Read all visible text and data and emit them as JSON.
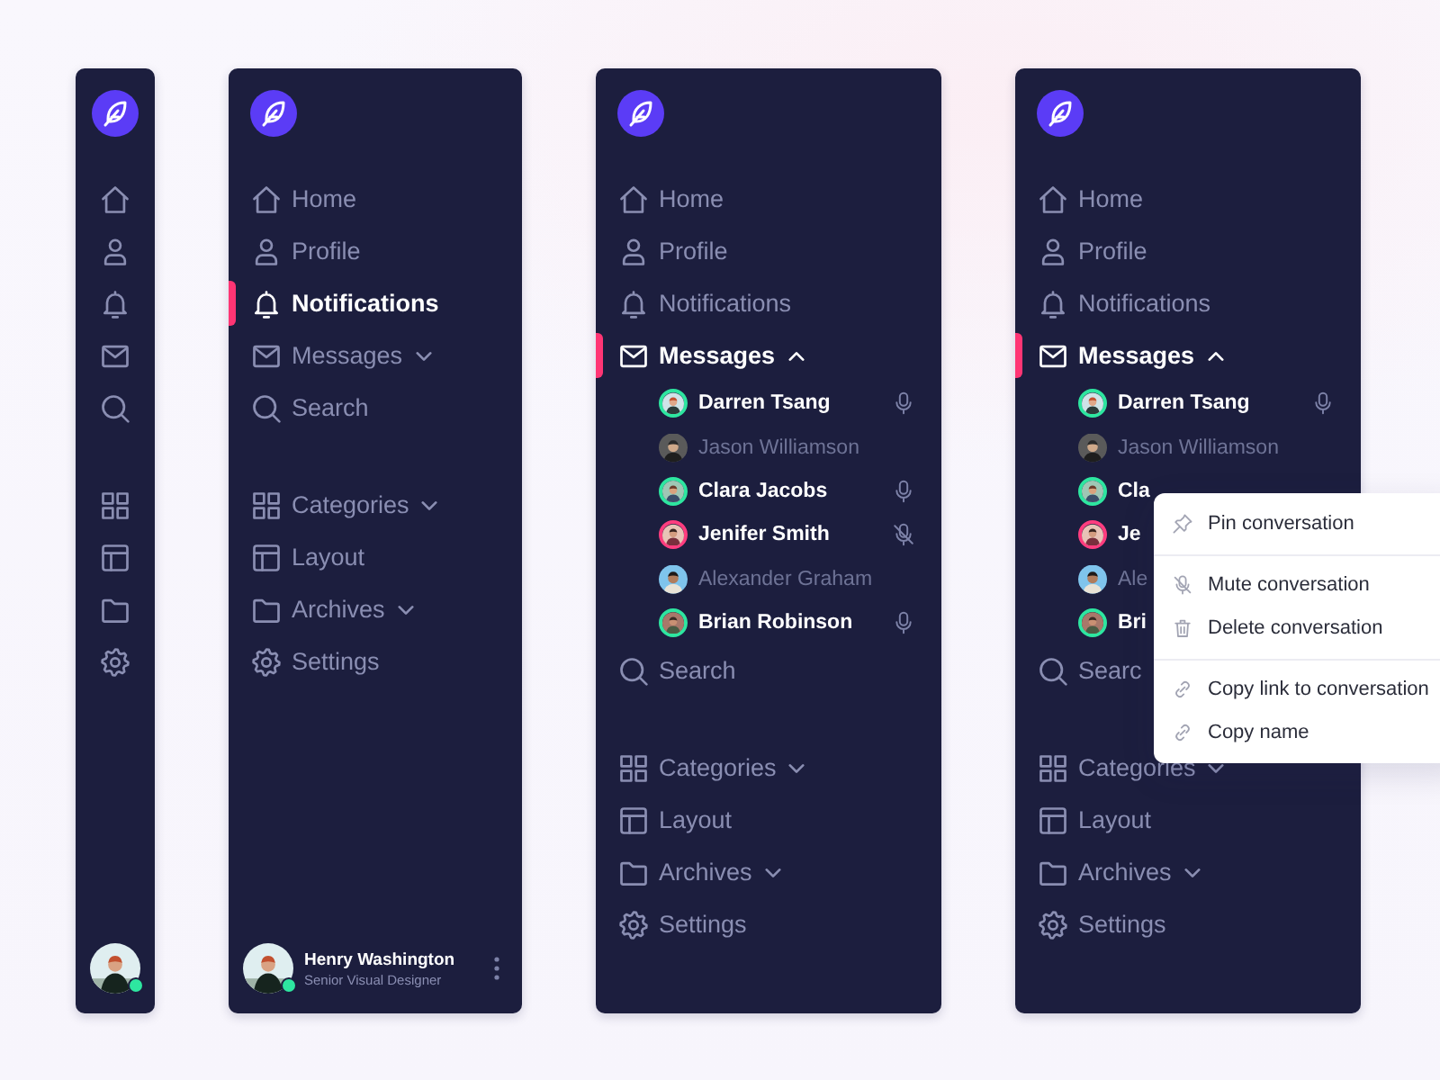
{
  "sidebars": [
    {
      "kind": "collapsed",
      "main": [
        {
          "selected": false
        },
        {
          "selected": false
        },
        {
          "selected": false
        },
        {
          "selected": false
        },
        {
          "selected": false
        }
      ],
      "secondary": [
        {
          "selected": false
        },
        {
          "selected": false
        },
        {
          "selected": false
        },
        {
          "selected": false
        }
      ],
      "user": {
        "online": true
      }
    },
    {
      "kind": "expanded",
      "main": [
        {
          "label": "Home",
          "selected": false
        },
        {
          "label": "Profile",
          "selected": false
        },
        {
          "label": "Notifications",
          "selected": true
        },
        {
          "label": "Messages",
          "selected": false,
          "expanded": false
        },
        {
          "label": "Search",
          "selected": false
        }
      ],
      "secondary": [
        {
          "label": "Categories",
          "selected": false,
          "expanded": false
        },
        {
          "label": "Layout",
          "selected": false
        },
        {
          "label": "Archives",
          "selected": false,
          "expanded": false
        },
        {
          "label": "Settings",
          "selected": false
        }
      ],
      "user": {
        "name": "Henry Washington",
        "role": "Senior Visual Designer",
        "online": true
      }
    },
    {
      "kind": "expanded",
      "main": [
        {
          "label": "Home",
          "selected": false
        },
        {
          "label": "Profile",
          "selected": false
        },
        {
          "label": "Notifications",
          "selected": false
        },
        {
          "label": "Messages",
          "selected": true,
          "expanded": true,
          "contacts": [
            {
              "name": "Darren Tsang",
              "active": true,
              "color": "#2ee6a0",
              "in_call": true,
              "muted": false
            },
            {
              "name": "Jason Williamson",
              "active": false,
              "in_call": false
            },
            {
              "name": "Clara Jacobs",
              "active": true,
              "color": "#2ee6a0",
              "in_call": true,
              "muted": false
            },
            {
              "name": "Jenifer Smith",
              "active": true,
              "color": "#ff3d7f",
              "in_call": true,
              "muted": true
            },
            {
              "name": "Alexander Graham",
              "active": false,
              "in_call": false
            },
            {
              "name": "Brian Robinson",
              "active": true,
              "color": "#2ee6a0",
              "in_call": true,
              "muted": false
            }
          ]
        },
        {
          "label": "Search",
          "selected": false
        }
      ],
      "secondary": [
        {
          "label": "Categories",
          "selected": false,
          "expanded": false
        },
        {
          "label": "Layout",
          "selected": false
        },
        {
          "label": "Archives",
          "selected": false,
          "expanded": false
        },
        {
          "label": "Settings",
          "selected": false
        }
      ]
    },
    {
      "kind": "expanded",
      "main": [
        {
          "label": "Home",
          "selected": false
        },
        {
          "label": "Profile",
          "selected": false
        },
        {
          "label": "Notifications",
          "selected": false
        },
        {
          "label": "Messages",
          "selected": true,
          "expanded": true,
          "contacts": [
            {
              "name": "Darren Tsang",
              "active": true,
              "color": "#2ee6a0",
              "in_call": true,
              "muted": false
            },
            {
              "name": "Jason Williamson",
              "active": false,
              "in_call": false
            },
            {
              "name": "Cla",
              "active": true,
              "color": "#2ee6a0"
            },
            {
              "name": "Je",
              "active": true,
              "color": "#ff3d7f"
            },
            {
              "name": "Ale",
              "active": false
            },
            {
              "name": "Bri",
              "active": true,
              "color": "#2ee6a0"
            }
          ]
        },
        {
          "label": "Searc",
          "selected": false
        }
      ],
      "secondary": [
        {
          "label": "Categories",
          "selected": false,
          "expanded": false
        },
        {
          "label": "Layout",
          "selected": false
        },
        {
          "label": "Archives",
          "selected": false,
          "expanded": false
        },
        {
          "label": "Settings",
          "selected": false
        }
      ],
      "context_menu": {
        "sections": [
          [
            {
              "label": "Pin conversation"
            }
          ],
          [
            {
              "label": "Mute conversation"
            },
            {
              "label": "Delete conversation"
            }
          ],
          [
            {
              "label": "Copy link to conversation"
            },
            {
              "label": "Copy name"
            }
          ]
        ]
      }
    }
  ]
}
